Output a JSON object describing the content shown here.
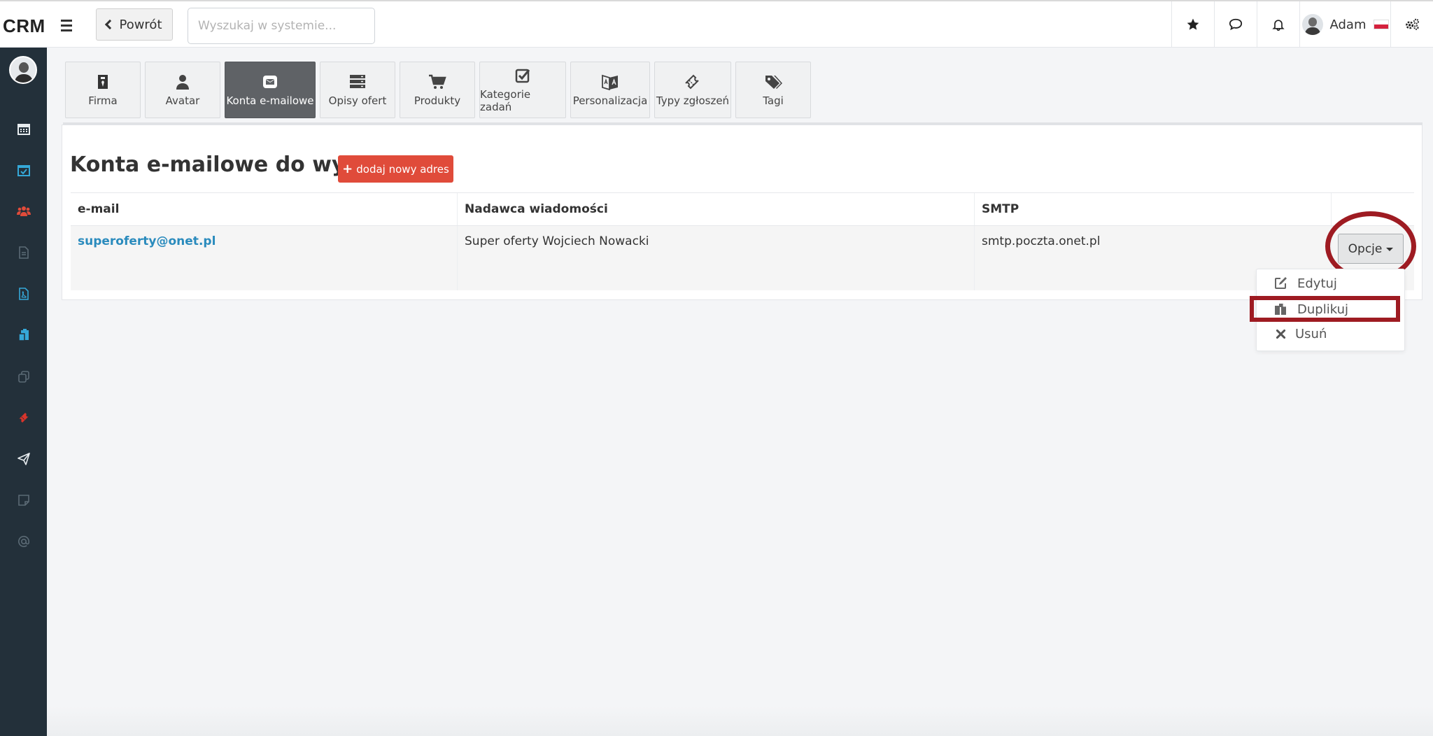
{
  "app": {
    "brand": "CRM",
    "back_label": "Powrót",
    "search_placeholder": "Wyszukaj w systemie..."
  },
  "topbar": {
    "user_name": "Adam",
    "icons": [
      "star-icon",
      "chat-icon",
      "bell-icon",
      "settings-icon"
    ]
  },
  "sidebar": {
    "items": [
      "calendar-icon",
      "calendar-check-icon",
      "users-icon",
      "document-icon",
      "pdf-icon",
      "clipboard-icon",
      "copy-icon",
      "ticket-icon",
      "paper-plane-icon",
      "sticky-note-icon",
      "at-icon"
    ]
  },
  "tabs": [
    {
      "label": "Firma",
      "icon": "building-icon"
    },
    {
      "label": "Avatar",
      "icon": "user-icon"
    },
    {
      "label": "Konta e-mailowe",
      "icon": "envelope-icon",
      "active": true
    },
    {
      "label": "Opisy ofert",
      "icon": "server-icon"
    },
    {
      "label": "Produkty",
      "icon": "cart-icon"
    },
    {
      "label": "Kategorie zadań",
      "icon": "checkbox-icon"
    },
    {
      "label": "Personalizacja",
      "icon": "translate-icon"
    },
    {
      "label": "Typy zgłoszeń",
      "icon": "ticket-icon"
    },
    {
      "label": "Tagi",
      "icon": "tags-icon"
    }
  ],
  "page": {
    "title": "Konta e-mailowe do wysyłki",
    "add_button": "dodaj nowy adres"
  },
  "table": {
    "columns": [
      "e-mail",
      "Nadawca wiadomości",
      "SMTP"
    ],
    "rows": [
      {
        "email": "superoferty@onet.pl",
        "sender": "Super oferty Wojciech Nowacki",
        "smtp": "smtp.poczta.onet.pl"
      }
    ]
  },
  "options": {
    "button_label": "Opcje",
    "menu": [
      {
        "label": "Edytuj",
        "icon": "edit-icon"
      },
      {
        "label": "Duplikuj",
        "icon": "duplicate-icon"
      },
      {
        "label": "Usuń",
        "icon": "close-icon"
      }
    ]
  },
  "colors": {
    "sidebar_bg": "#23303a",
    "accent_red": "#e04b3a",
    "annotation": "#9e1b22",
    "link": "#2a8bbd"
  }
}
